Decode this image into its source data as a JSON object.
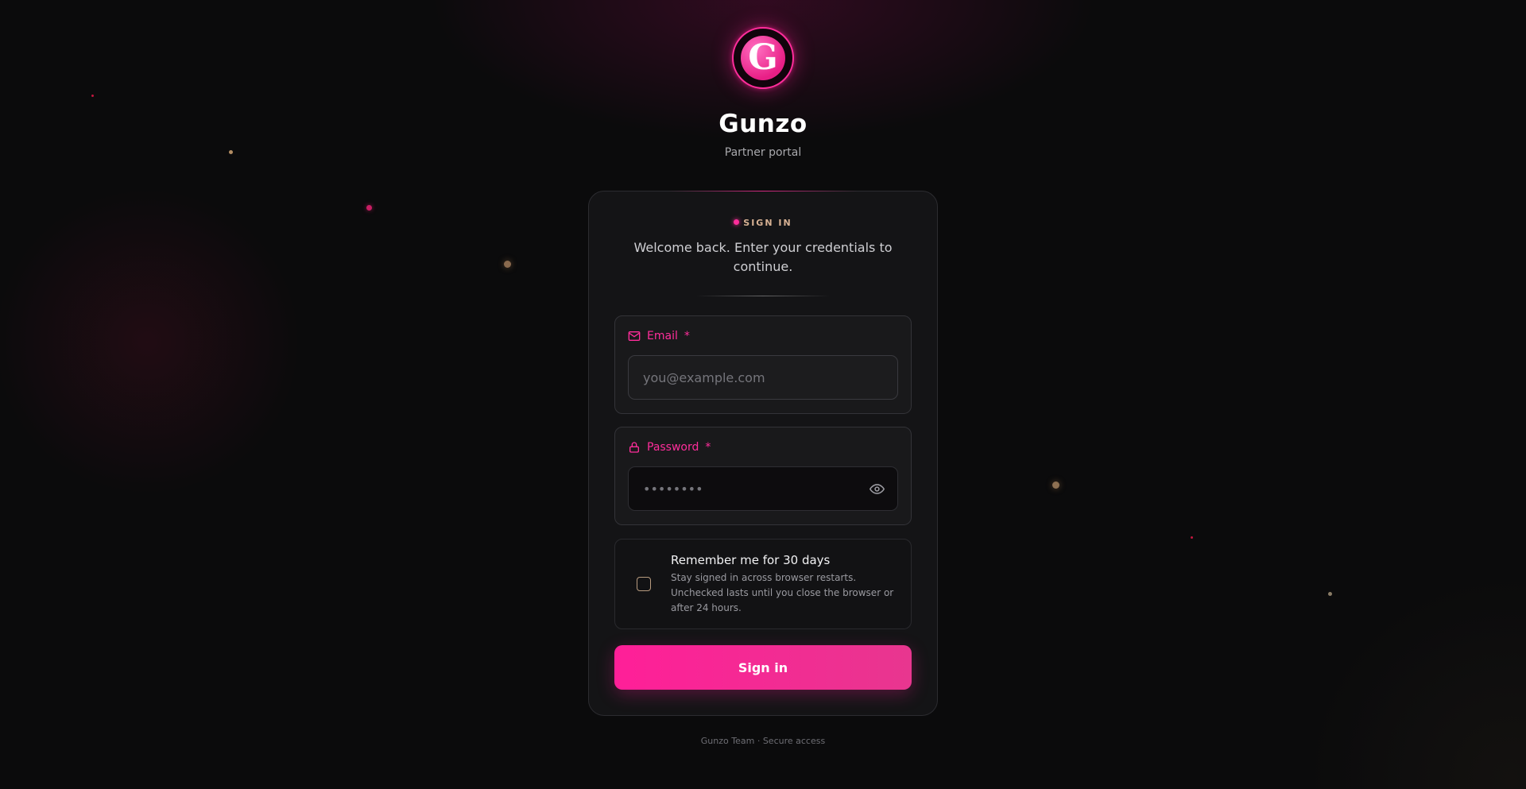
{
  "brand": {
    "logo_letter": "G",
    "name": "Gunzo",
    "subtitle": "Partner portal"
  },
  "card": {
    "kicker": "SIGN IN",
    "welcome": "Welcome back. Enter your credentials to continue."
  },
  "email_field": {
    "label": "Email",
    "required_mark": "*",
    "placeholder": "you@example.com",
    "icon": "mail-icon"
  },
  "password_field": {
    "label": "Password",
    "required_mark": "*",
    "placeholder": "••••••••",
    "icon": "lock-icon",
    "toggle_icon": "eye-icon"
  },
  "remember": {
    "title": "Remember me for 30 days",
    "description": "Stay signed in across browser restarts. Unchecked lasts until you close the browser or after 24 hours.",
    "checked": false
  },
  "signin_button": {
    "label": "Sign in"
  },
  "footer": {
    "text": "Gunzo Team · Secure access"
  },
  "colors": {
    "accent": "#ff1f98",
    "background": "#0b0b0c",
    "card": "#141416",
    "kicker": "#d8b294"
  }
}
